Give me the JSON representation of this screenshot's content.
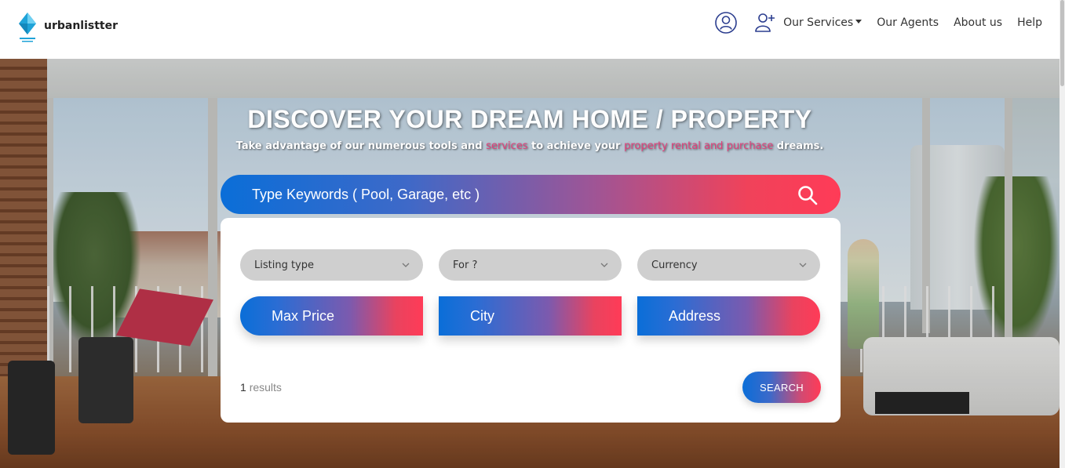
{
  "brand": {
    "name": "urbanlistter",
    "accent": "#1fa3d8"
  },
  "nav": {
    "icons": [
      "user-circle-icon",
      "add-user-icon"
    ],
    "links": [
      "Our Services",
      "Our Agents",
      "About us",
      "Help"
    ]
  },
  "hero": {
    "title": "DISCOVER YOUR DREAM HOME / PROPERTY",
    "subtitle": {
      "part1": "Take advantage of our numerous tools and ",
      "highlight1": "services",
      "part2": " to achieve your ",
      "highlight2": "property rental and purchase",
      "part3": " dreams."
    }
  },
  "search": {
    "placeholder": "Type Keywords ( Pool, Garage, etc )",
    "icon": "search-icon",
    "gradient": [
      "#0a6ed8",
      "#ff3b57"
    ]
  },
  "filters": {
    "selects": [
      {
        "label": "Listing type"
      },
      {
        "label": "For ?"
      },
      {
        "label": "Currency"
      }
    ],
    "fields": [
      {
        "label": "Max Price"
      },
      {
        "label": "City"
      },
      {
        "label": "Address"
      }
    ]
  },
  "results": {
    "count": "1",
    "label": "results"
  },
  "submit": {
    "label": "SEARCH"
  }
}
